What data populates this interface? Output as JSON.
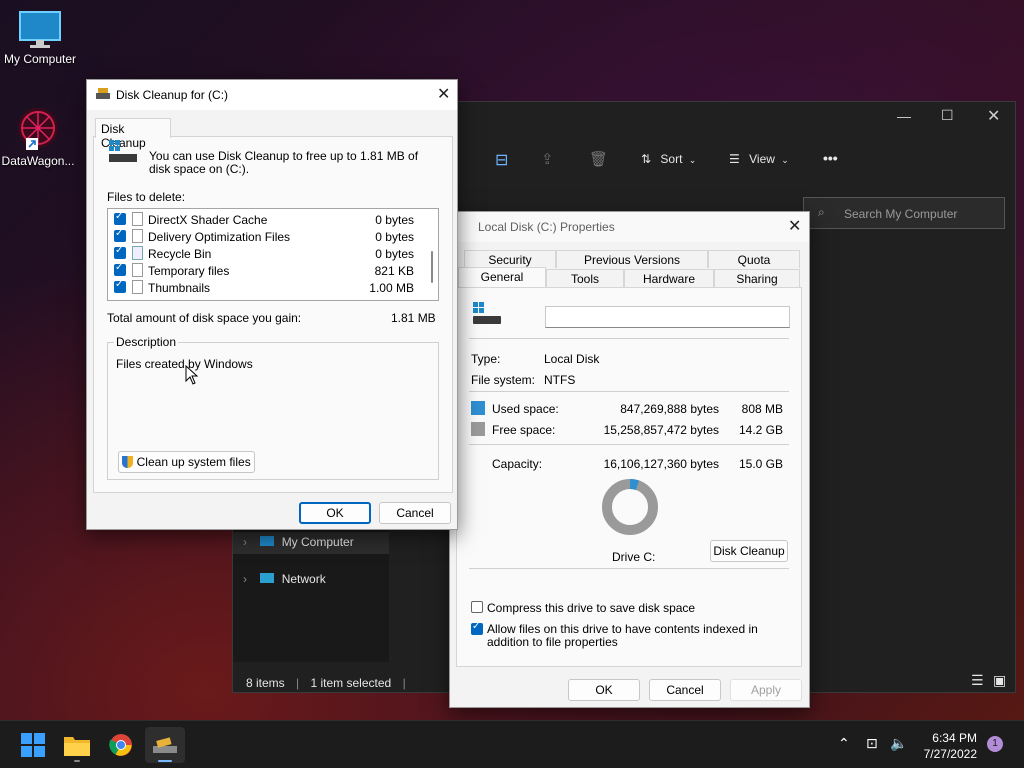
{
  "desktop": {
    "icons": [
      {
        "label": "My Computer",
        "icon": "monitor-icon"
      },
      {
        "label": "DataWagon...",
        "icon": "datawagon-shortcut-icon"
      }
    ]
  },
  "explorer": {
    "toolbar": {
      "sort_label": "Sort",
      "view_label": "View",
      "more_label": "•••"
    },
    "search_placeholder": "Search My Computer",
    "nav": [
      {
        "label": "My Computer"
      },
      {
        "label": "Network"
      }
    ],
    "status": {
      "items": "8 items",
      "selected": "1 item selected"
    }
  },
  "disk_cleanup": {
    "title": "Disk Cleanup for  (C:)",
    "tab": "Disk Cleanup",
    "intro": "You can use Disk Cleanup to free up to 1.81 MB of disk space on  (C:).",
    "files_to_delete_label": "Files to delete:",
    "files": [
      {
        "name": "DirectX Shader Cache",
        "size": "0 bytes",
        "checked": true
      },
      {
        "name": "Delivery Optimization Files",
        "size": "0 bytes",
        "checked": true
      },
      {
        "name": "Recycle Bin",
        "size": "0 bytes",
        "checked": true
      },
      {
        "name": "Temporary files",
        "size": "821 KB",
        "checked": true
      },
      {
        "name": "Thumbnails",
        "size": "1.00 MB",
        "checked": true
      }
    ],
    "total_label": "Total amount of disk space you gain:",
    "total_value": "1.81 MB",
    "description_label": "Description",
    "description_text": "Files created by Windows",
    "cleanup_system_label": "Clean up system files",
    "ok_label": "OK",
    "cancel_label": "Cancel"
  },
  "properties": {
    "title": "Local Disk (C:) Properties",
    "tabs_row1": [
      "Security",
      "Previous Versions",
      "Quota"
    ],
    "tabs_row2": [
      "General",
      "Tools",
      "Hardware",
      "Sharing"
    ],
    "active_tab": "General",
    "name_value": "",
    "type_label": "Type:",
    "type_value": "Local Disk",
    "fs_label": "File system:",
    "fs_value": "NTFS",
    "used_label": "Used space:",
    "used_bytes": "847,269,888 bytes",
    "used_short": "808 MB",
    "free_label": "Free space:",
    "free_bytes": "15,258,857,472 bytes",
    "free_short": "14.2 GB",
    "capacity_label": "Capacity:",
    "capacity_bytes": "16,106,127,360 bytes",
    "capacity_short": "15.0 GB",
    "used_fraction": 0.0526,
    "drive_label": "Drive C:",
    "disk_cleanup_button": "Disk Cleanup",
    "compress_label": "Compress this drive to save disk space",
    "compress_checked": false,
    "index_label": "Allow files on this drive to have contents indexed in addition to file properties",
    "index_checked": true,
    "ok_label": "OK",
    "cancel_label": "Cancel",
    "apply_label": "Apply",
    "colors": {
      "used": "#2f8fd0",
      "free": "#9a9a9a"
    }
  },
  "taskbar": {
    "apps": [
      "start-icon",
      "file-explorer-icon",
      "chrome-icon",
      "disk-cleanup-icon"
    ],
    "time": "6:34 PM",
    "date": "7/27/2022",
    "notification_count": "1"
  }
}
